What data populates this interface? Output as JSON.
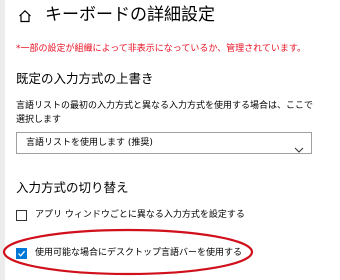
{
  "page": {
    "title": "キーボードの詳細設定",
    "home_icon": "home-icon",
    "policy_notice": "*一部の設定が組織によって非表示になっているか、管理されています。",
    "notice_color": "#e81123"
  },
  "override_section": {
    "heading": "既定の入力方式の上書き",
    "description": "言語リストの最初の入力方式と異なる入力方式を使用する場合は、ここで選択します",
    "select": {
      "selected_value": "言語リストを使用します (推奨)",
      "chevron_icon": "chevron-down-icon"
    }
  },
  "switching_section": {
    "heading": "入力方式の切り替え",
    "options": [
      {
        "label": "アプリ ウィンドウごとに異なる入力方式を設定する",
        "checked": false
      },
      {
        "label": "使用可能な場合にデスクトップ言語バーを使用する",
        "checked": true
      }
    ]
  },
  "colors": {
    "accent": "#0078d7",
    "highlight_annotation": "#d0101b"
  }
}
